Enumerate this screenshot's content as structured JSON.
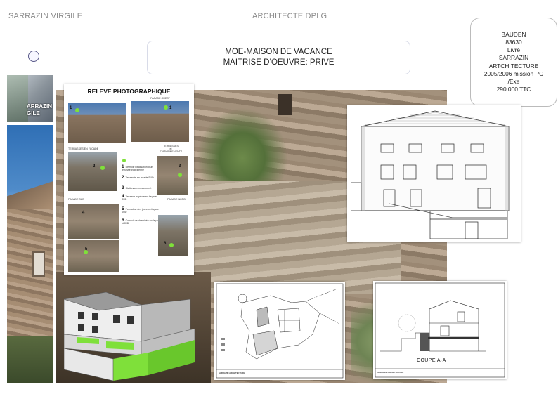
{
  "header": {
    "name": "SARRAZIN VIRGILE",
    "profession": "ARCHITECTE DPLG"
  },
  "project": {
    "line1": "MOE-MAISON  DE  VACANCE",
    "line2": "MAITRISE D’OEUVRE: PRIVE"
  },
  "info": {
    "lines": [
      "BAUDEN",
      "83630",
      "Livré",
      "SARRAZIN",
      "ARTCHITECTURE",
      "2005/2006  mission PC",
      "/Exe",
      "290 000 TTC"
    ]
  },
  "logo_thumb": {
    "text": "ARRAZIN\nGILE"
  },
  "releve": {
    "title": "RELEVE PHOTOGRAPHIQUE",
    "captions": {
      "ouest": "FACADE OUEST",
      "terrasses_facade": "TERRASSES EN FACADE",
      "terrasses_stat": "TERRASSES\net\nSTATIONNEMENTS",
      "sud": "FACADE SUD",
      "nord": "FACADE NORD"
    },
    "legend": [
      {
        "n": "1",
        "text": "Démolie Réalisation d’un terrasse tropézienne"
      },
      {
        "n": "2",
        "text": "Terrassée en façade SUD"
      },
      {
        "n": "3",
        "text": "Stationnements couvert"
      },
      {
        "n": "4",
        "text": "Terrasse tropézienne façade SUD"
      },
      {
        "n": "5",
        "text": "Formation des jours en façade SUD"
      },
      {
        "n": "6",
        "text": "Conduit de cheminée en façade NORD"
      }
    ],
    "photo_numbers": [
      "1",
      "1",
      "2",
      "3",
      "4",
      "5",
      "6"
    ]
  },
  "section_drawing": {
    "label": "COUPE  A-A"
  },
  "title_blocks": {
    "plan": "SARRAZIN ARCHITECTURE",
    "section": "SARRAZIN ARCHITECTURE"
  },
  "colors": {
    "accent_green": "#7fe03a",
    "border": "#d8dbe8"
  }
}
